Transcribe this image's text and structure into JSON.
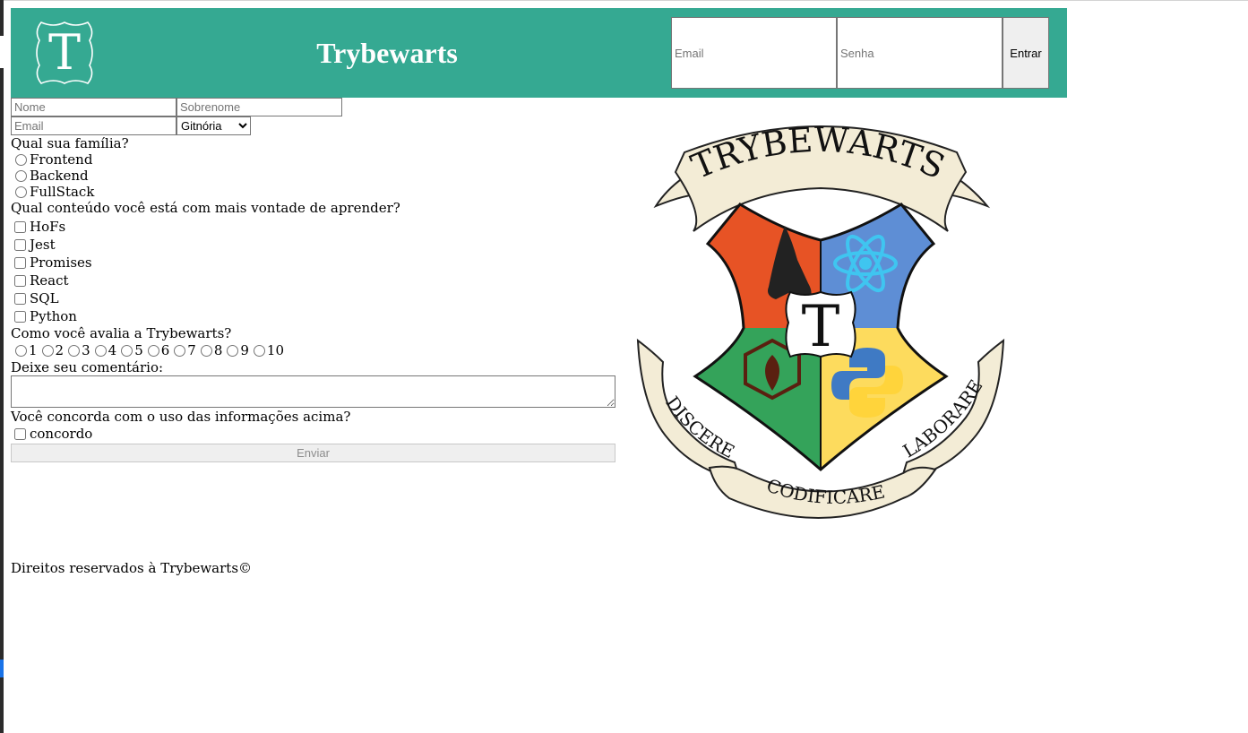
{
  "header": {
    "logo_letter": "T",
    "title": "Trybewarts",
    "login": {
      "email_placeholder": "Email",
      "password_placeholder": "Senha",
      "submit_label": "Entrar"
    }
  },
  "form": {
    "name_placeholder": "Nome",
    "lastname_placeholder": "Sobrenome",
    "email_placeholder": "Email",
    "house_selected": "Gitnória",
    "family_question": "Qual sua família?",
    "families": [
      "Frontend",
      "Backend",
      "FullStack"
    ],
    "content_question": "Qual conteúdo você está com mais vontade de aprender?",
    "subjects": [
      "HoFs",
      "Jest",
      "Promises",
      "React",
      "SQL",
      "Python"
    ],
    "rate_question": "Como você avalia a Trybewarts?",
    "rates": [
      "1",
      "2",
      "3",
      "4",
      "5",
      "6",
      "7",
      "8",
      "9",
      "10"
    ],
    "comment_label": "Deixe seu comentário:",
    "agreement_question": "Você concorda com o uso das informações acima?",
    "agreement_label": "concordo",
    "submit_label": "Enviar"
  },
  "crest": {
    "banner_top": "TRYBEWARTS",
    "center_letter": "T",
    "motto_left": "DISCERE",
    "motto_bottom": "CODIFICARE",
    "motto_right": "LABORARE"
  },
  "footer": {
    "text": "Direitos reservados à Trybewarts©"
  },
  "colors": {
    "header_bg": "#35a992",
    "crest_orange": "#e75325",
    "crest_blue": "#5e8ed5",
    "crest_green": "#34a35a",
    "crest_yellow": "#fddb5d",
    "banner_cream": "#f3ecd6"
  }
}
